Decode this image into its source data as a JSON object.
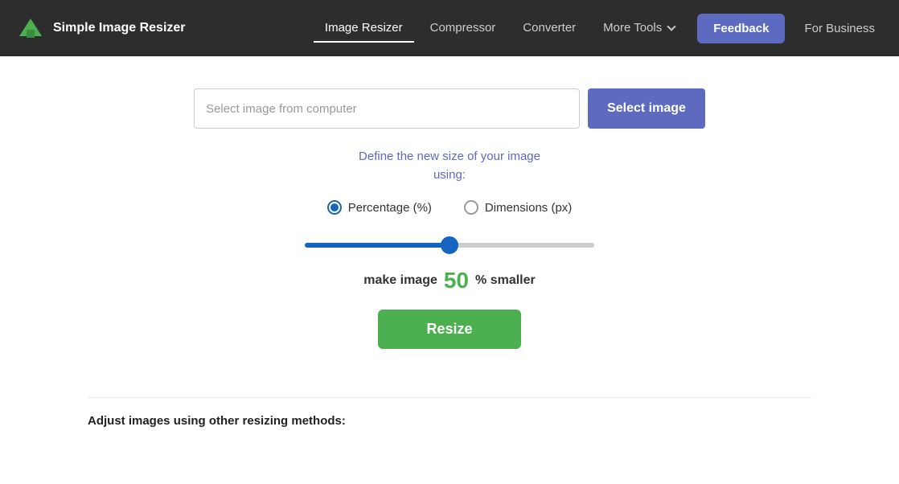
{
  "header": {
    "logo_text": "Simple Image Resizer",
    "nav": [
      {
        "id": "image-resizer",
        "label": "Image Resizer",
        "active": true
      },
      {
        "id": "compressor",
        "label": "Compressor",
        "active": false
      },
      {
        "id": "converter",
        "label": "Converter",
        "active": false
      },
      {
        "id": "more-tools",
        "label": "More Tools",
        "active": false,
        "has_dropdown": true
      }
    ],
    "feedback_label": "Feedback",
    "for_business_label": "For Business"
  },
  "main": {
    "file_input_placeholder": "Select image from computer",
    "select_image_btn_label": "Select image",
    "define_text_line1": "Define the new size of your image",
    "define_text_line2": "using:",
    "radio_options": [
      {
        "id": "percentage",
        "label": "Percentage (%)",
        "checked": true
      },
      {
        "id": "dimensions",
        "label": "Dimensions (px)",
        "checked": false
      }
    ],
    "slider_value": 50,
    "make_image_prefix": "make image",
    "make_image_suffix": "% smaller",
    "resize_btn_label": "Resize"
  },
  "bottom": {
    "title": "Adjust images using other resizing methods:"
  }
}
